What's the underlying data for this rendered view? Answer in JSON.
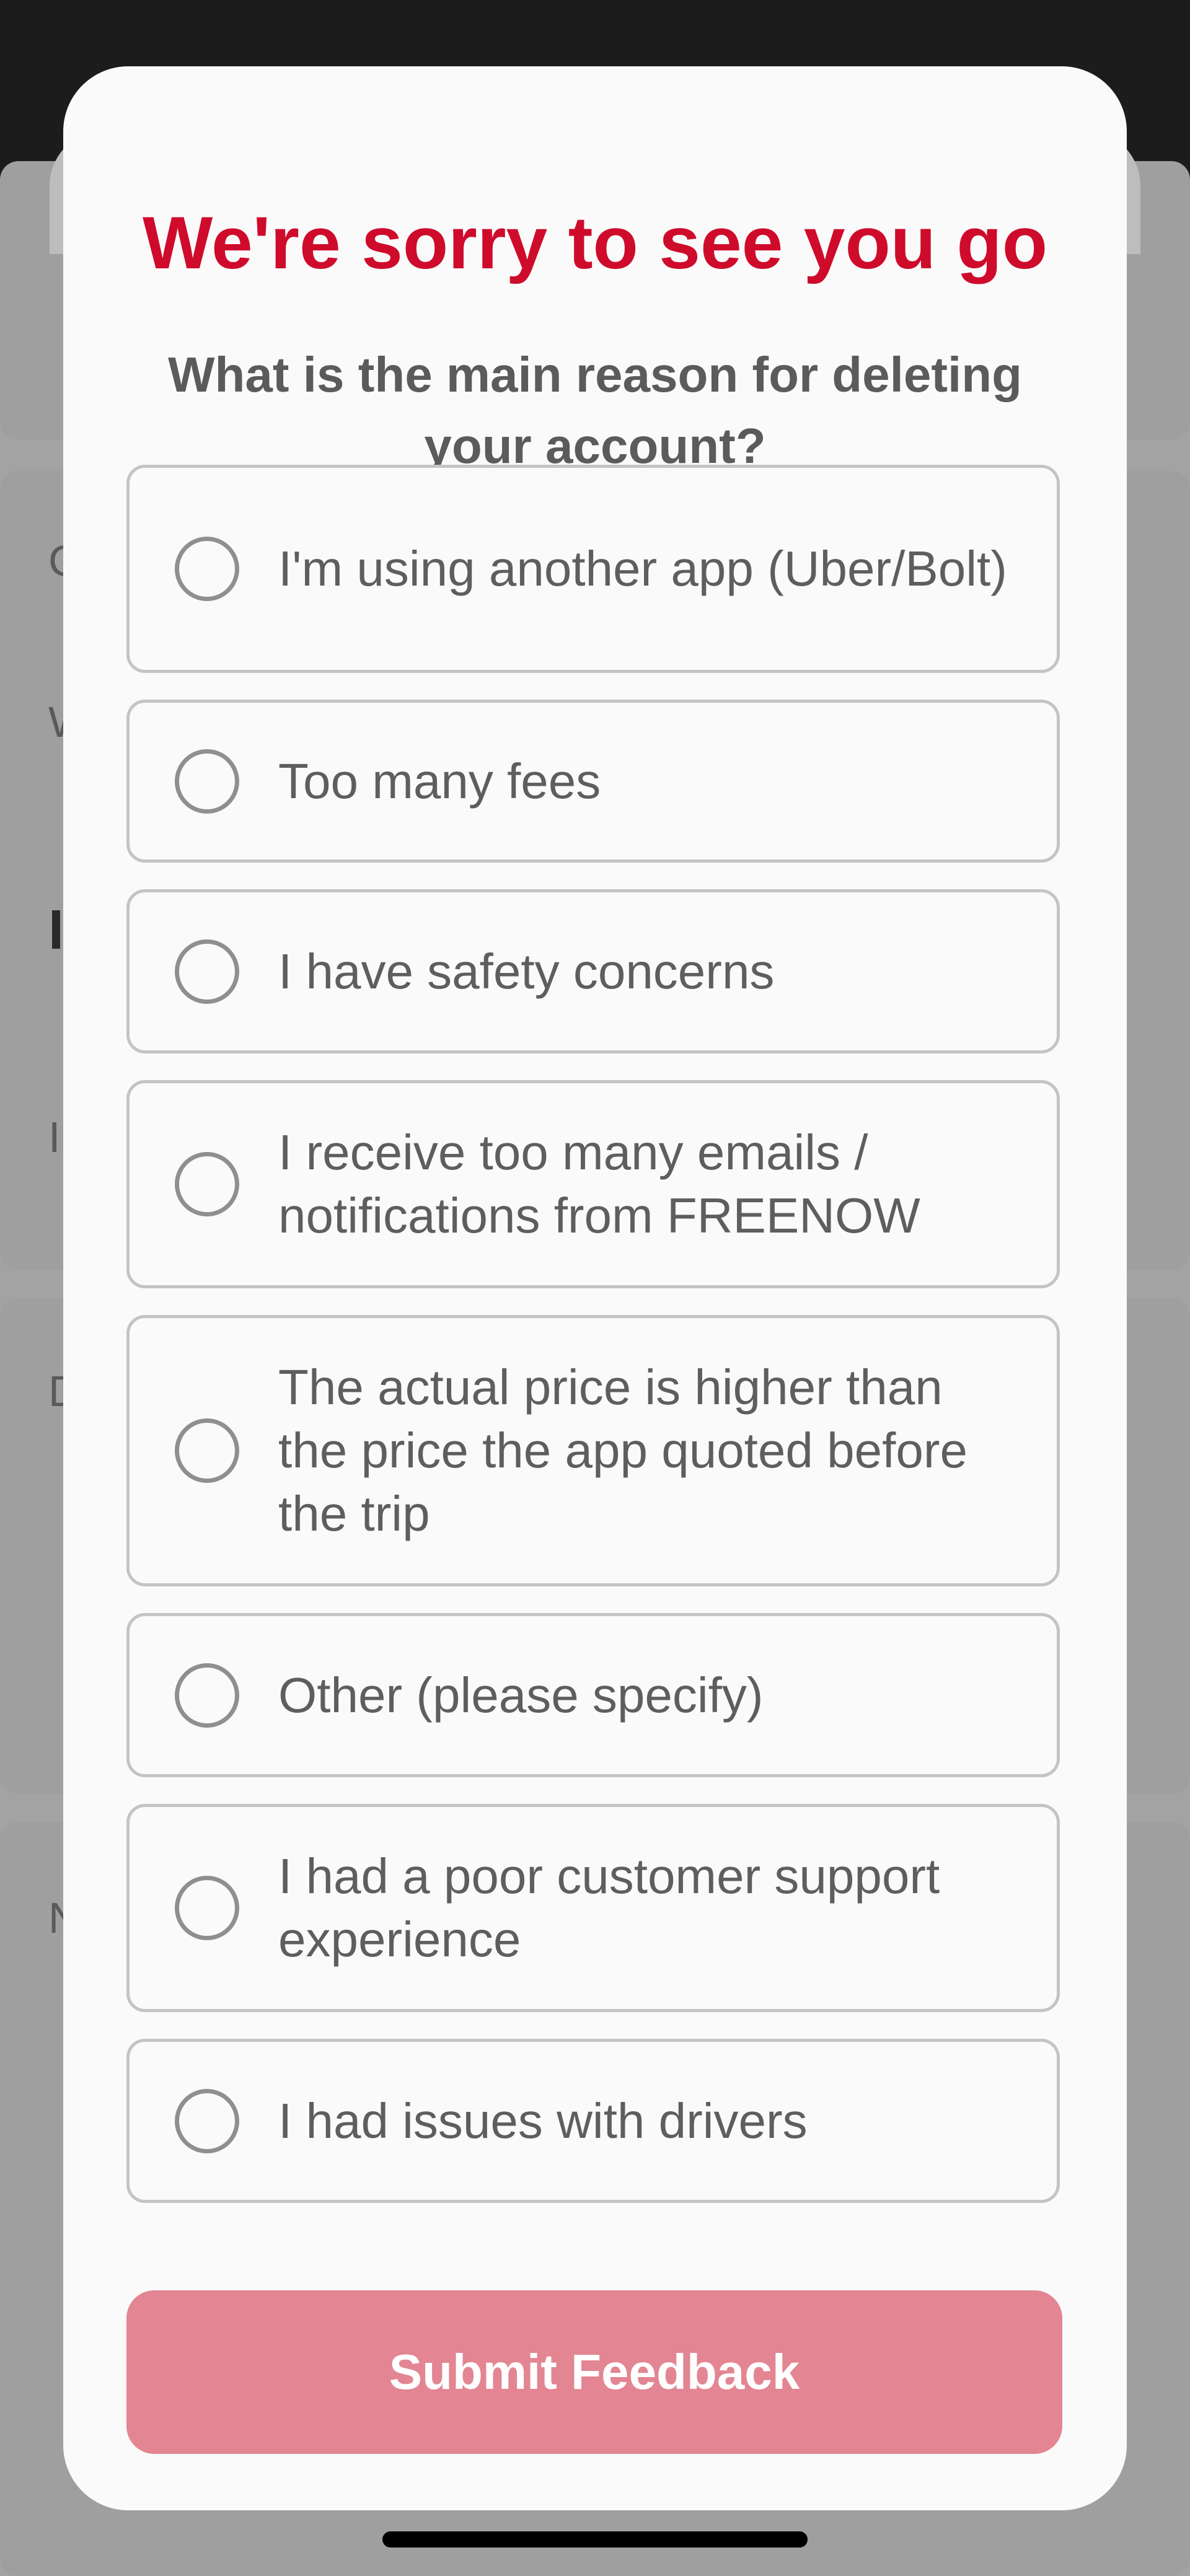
{
  "colors": {
    "title": "#cf0b2b",
    "submit_background": "#e38592",
    "option_border": "#c4c4c4",
    "text_gray": "#5e5e5e"
  },
  "background_screen": {
    "letters": [
      "C",
      "W",
      "I",
      "I",
      "D",
      "N"
    ]
  },
  "modal": {
    "title": "We're sorry to see you go",
    "subtitle": "What is the main reason for deleting your account?",
    "options": [
      {
        "label": "I'm using another app (Uber/Bolt)",
        "selected": false
      },
      {
        "label": "Too many fees",
        "selected": false
      },
      {
        "label": "I have safety concerns",
        "selected": false
      },
      {
        "label": "I receive too many emails / notifications from FREENOW",
        "selected": false
      },
      {
        "label": "The actual price is higher than the price the app quoted before the trip",
        "selected": false
      },
      {
        "label": "Other (please specify)",
        "selected": false
      },
      {
        "label": "I had a poor customer support experience",
        "selected": false
      },
      {
        "label": "I had issues with drivers",
        "selected": false
      }
    ],
    "submit_label": "Submit Feedback"
  }
}
